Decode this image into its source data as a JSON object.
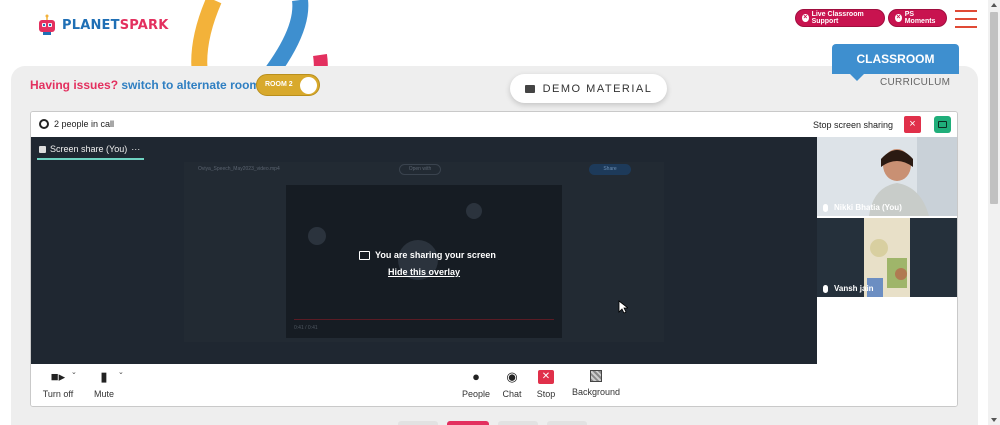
{
  "brand": {
    "name_part1": "PLANET",
    "name_part2": "SPARK"
  },
  "header": {
    "live_support_label": "Live Classroom Support",
    "ps_moments_label": "PS Moments"
  },
  "tabs": {
    "classroom": "CLASSROOM",
    "curriculum": "CURRICULUM"
  },
  "issues": {
    "prefix": "Having issues?",
    "suffix": "switch to alternate room",
    "toggle_label": "ROOM 2"
  },
  "demo_material_label": "DEMO MATERIAL",
  "call": {
    "people_count": "2 people in call",
    "stop_sharing_label": "Stop screen sharing",
    "stage_tab_label": "Screen share (You)",
    "stage_tab_more": "···",
    "overlay_message": "You are sharing your screen",
    "overlay_link": "Hide this overlay",
    "shared_window": {
      "file_title": "Oviya_Speech_May2023_video.mp4",
      "open_with": "Open with",
      "share": "Share",
      "time": "0:41 / 0:41"
    },
    "participants": [
      {
        "name": "Nikki Bhatia (You)"
      },
      {
        "name": "Vansh jain"
      }
    ],
    "controls": [
      {
        "label": "Turn off",
        "icon": "camera-icon"
      },
      {
        "label": "Mute",
        "icon": "microphone-icon"
      },
      {
        "label": "People",
        "icon": "people-icon"
      },
      {
        "label": "Chat",
        "icon": "chat-icon"
      },
      {
        "label": "Stop",
        "icon": "stop-share-icon"
      },
      {
        "label": "Background",
        "icon": "background-icon"
      }
    ]
  },
  "colors": {
    "brand_blue": "#3e8fcf",
    "brand_red": "#e3305f",
    "support_pill": "#c8134f",
    "toggle": "#d8a92c",
    "stop_red": "#e0304a",
    "share_green": "#1fae7a",
    "stage_bg": "#1f2731"
  }
}
